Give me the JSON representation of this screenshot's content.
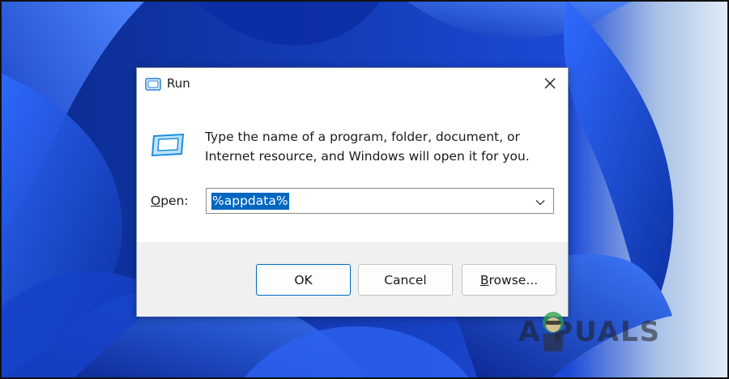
{
  "colors": {
    "accent": "#0067c0",
    "wallpaper_dark": "#0a2a8c",
    "wallpaper_light": "#dfe9f5",
    "footer_bg": "#f0f0f0"
  },
  "dialog": {
    "title": "Run",
    "title_icon": "run-icon",
    "close_icon": "close-icon",
    "app_icon": "run-icon",
    "message_line1": "Type the name of a program, folder, document, or",
    "message_line2": "Internet resource, and Windows will open it for you.",
    "open_label_key": "O",
    "open_label_rest": "pen:",
    "open_value": "%appdata%",
    "dropdown_icon": "chevron-down-icon"
  },
  "buttons": {
    "ok": "OK",
    "cancel": "Cancel",
    "browse_key": "B",
    "browse_rest": "rowse..."
  },
  "watermark": {
    "text": "A  PUALS",
    "logo": "appuals-mascot-logo"
  }
}
